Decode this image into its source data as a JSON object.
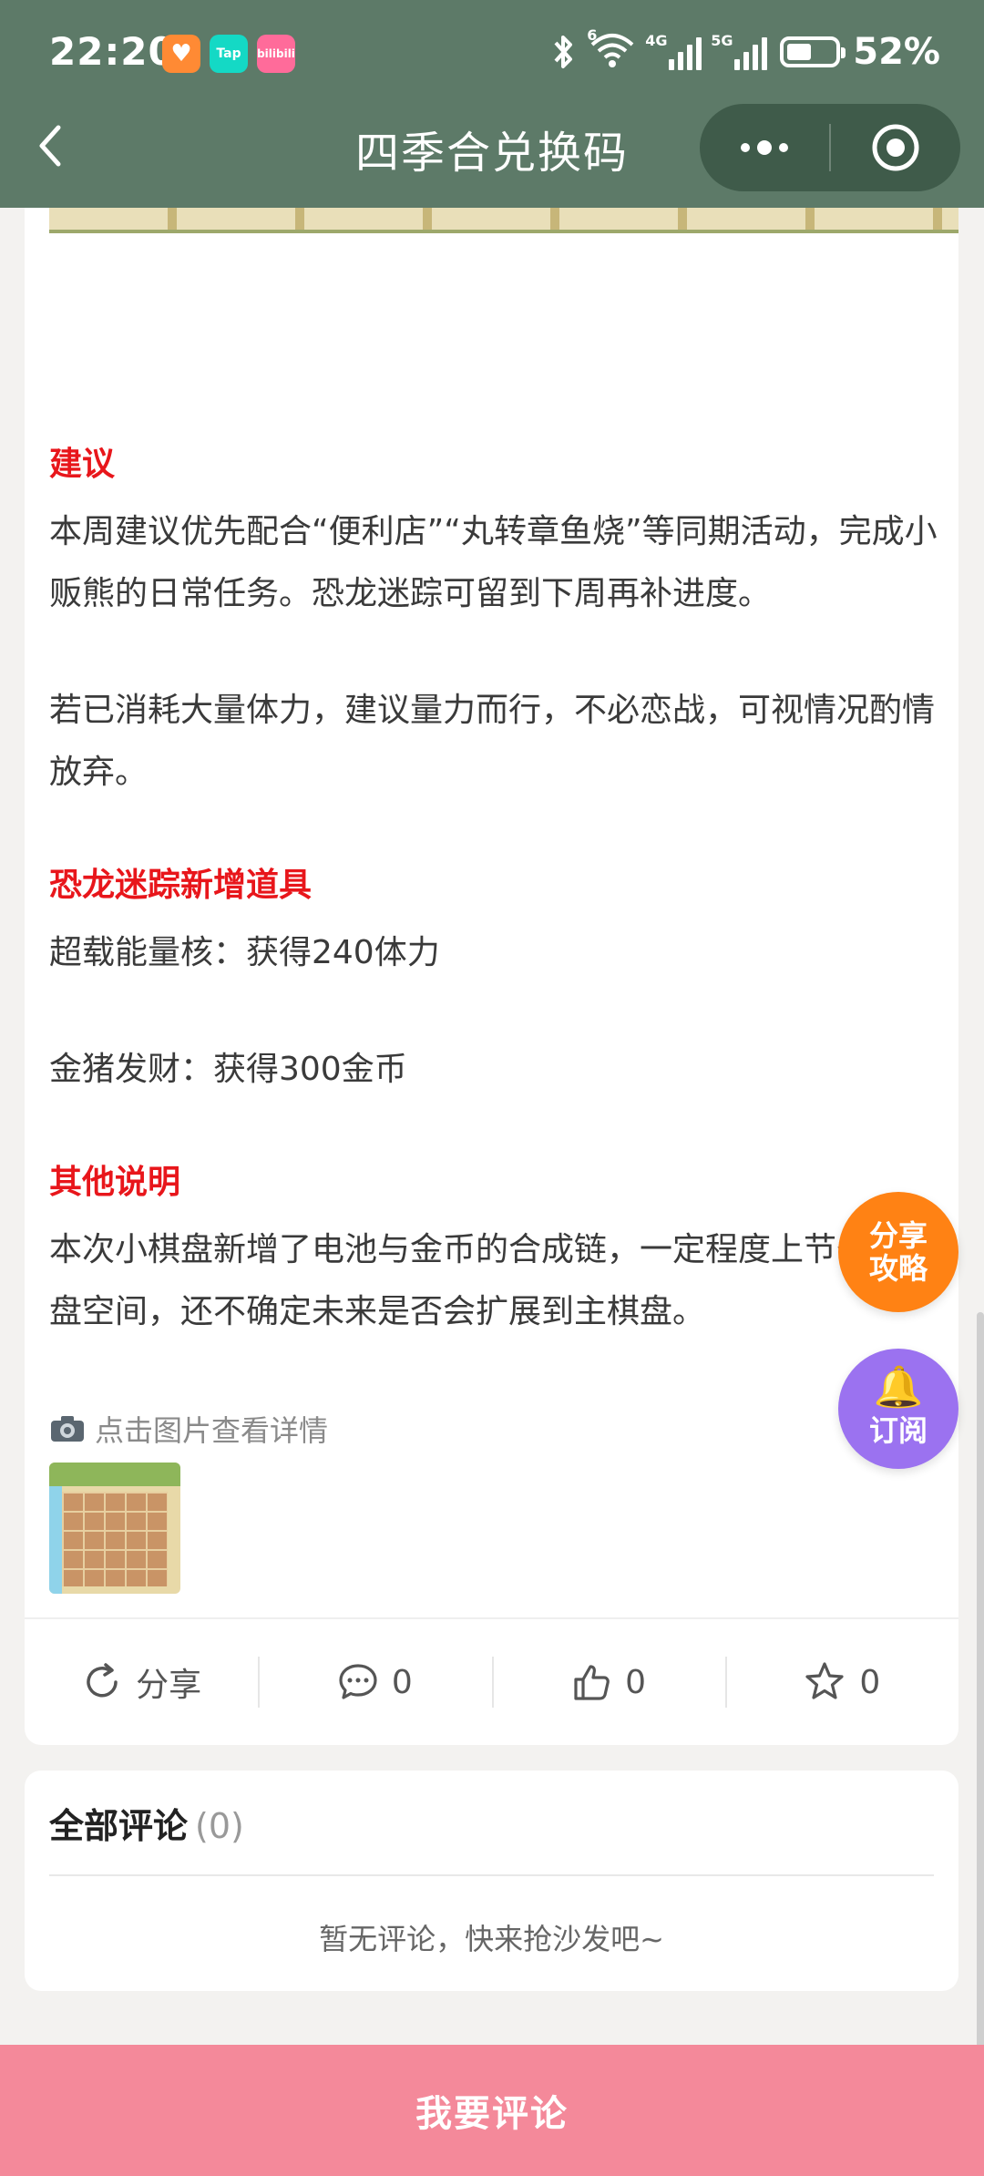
{
  "status_bar": {
    "time": "22:20",
    "apps": [
      "heart-app-icon",
      "TapTap",
      "bilibili"
    ],
    "tap_label": "Tap",
    "bili_label": "bilibili",
    "network_4g": "4G",
    "network_5g": "5G",
    "wifi_badge": "6",
    "battery_percent": 52,
    "battery_text": "52%"
  },
  "nav": {
    "title": "四季合兑换码"
  },
  "article": {
    "sections": [
      {
        "title": "建议"
      },
      {
        "para": "本周建议优先配合“便利店”“丸转章鱼烧”等同期活动，完成小贩熊的日常任务。恐龙迷踪可留到下周再补进度。"
      },
      {
        "para": "若已消耗大量体力，建议量力而行，不必恋战，可视情况酌情放弃。"
      },
      {
        "title": "恐龙迷踪新增道具"
      },
      {
        "para": "超载能量核：获得240体力"
      },
      {
        "para": "金猪发财：获得300金币"
      },
      {
        "title": "其他说明"
      },
      {
        "para": "本次小棋盘新增了电池与金币的合成链，一定程度上节省了棋盘空间，还不确定未来是否会扩展到主棋盘。"
      }
    ],
    "photo_hint": "点击图片查看详情"
  },
  "actions": {
    "share_label": "分享",
    "comment_count": "0",
    "like_count": "0",
    "favorite_count": "0"
  },
  "comments": {
    "title": "全部评论",
    "count": "(0)",
    "empty": "暂无评论，快来抢沙发吧~"
  },
  "floating": {
    "share_line1": "分享",
    "share_line2": "攻略",
    "subscribe": "订阅"
  },
  "bottom": {
    "comment_button": "我要评论"
  },
  "colors": {
    "header": "#5d7a68",
    "section_title": "#e8161b",
    "share_fab": "#ff8214",
    "subscribe_fab": "#9b72f0",
    "bottom_bar": "#f4899a"
  }
}
